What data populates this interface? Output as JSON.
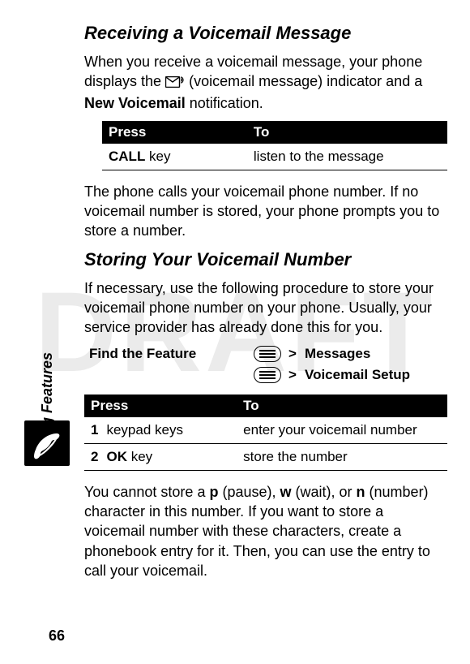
{
  "watermark": "DRAFT",
  "side_label": "Calling Features",
  "page_number": "66",
  "section1": {
    "title": "Receiving a Voicemail Message",
    "p1_a": "When you receive a voicemail message, your phone displays the ",
    "p1_b": " (voicemail message) indicator and a ",
    "p1_c": " notification.",
    "notif": "New Voicemail",
    "vm_icon_name": "voicemail-envelope-icon",
    "table": {
      "h1": "Press",
      "h2": "To",
      "r1_key": "CALL",
      "r1_rest": " key",
      "r1_action": "listen to the message"
    },
    "p2": "The phone calls your voicemail phone number. If no voicemail number is stored, your phone prompts you to store a number."
  },
  "section2": {
    "title": "Storing Your Voicemail Number",
    "p1": "If necessary, use the following procedure to store your voicemail phone number on your phone. Usually, your service provider has already done this for you.",
    "ftf_label": "Find the Feature",
    "ftf_gt": ">",
    "ftf_item1": "Messages",
    "ftf_item2": "Voicemail Setup",
    "table": {
      "h1": "Press",
      "h2": "To",
      "r1_step": "1",
      "r1_press": "keypad keys",
      "r1_action": "enter your voicemail number",
      "r2_step": "2",
      "r2_key": "OK",
      "r2_rest": " key",
      "r2_action": "store the number"
    },
    "p2_a": "You cannot store a ",
    "p2_b": " (pause), ",
    "p2_c": " (wait), or ",
    "p2_d": " (number) character in this number. If you want to store a voicemail number with these characters, create a phonebook entry for it. Then, you can use the entry to call your voicemail.",
    "char_p": "p",
    "char_w": "w",
    "char_n": "n"
  }
}
